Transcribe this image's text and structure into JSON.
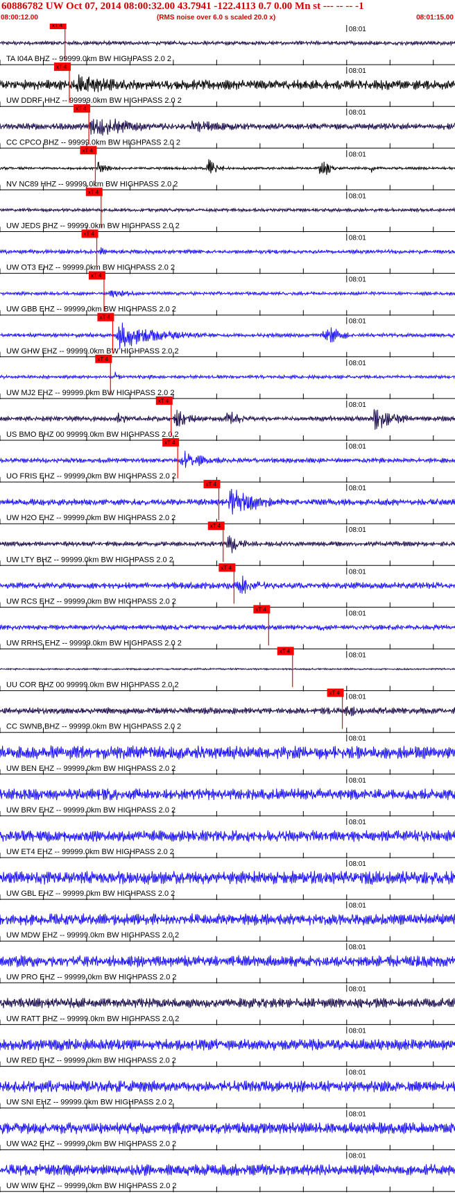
{
  "header": {
    "title": "60886782 UW Oct 07, 2014 08:00:32.00   43.7941 -122.4113  0.7 0.00 Mn st --- -- --   -1",
    "start_time": "08:00:12.00",
    "rms_note": "(RMS noise over 6.0 s scaled 20.0 x)",
    "end_time": "08:01:15.00"
  },
  "colors": {
    "header_red": "#d40000",
    "blue_trace": "#1a10ff",
    "dark_trace": "#1a0a4a",
    "black_trace": "#000000",
    "pick_red": "#ff0000"
  },
  "chart_data": {
    "type": "line",
    "title": "60886782 UW Oct 07, 2014 08:00:32.00   43.7941 -122.4113  0.7 0.00 Mn st --- -- --   -1",
    "x_start": "08:00:12.00",
    "x_end": "08:01:15.00",
    "x_tick_label": "08:01",
    "x_tick_label_time_s": 48,
    "pick_label": "xT 4",
    "xlim_seconds": [
      0,
      63
    ],
    "grid": false,
    "series": [
      {
        "name": "TA I04A BHZ -- 99999.0km BW  HIGHPASS  2.0  2",
        "color": "dark",
        "pick_s": 9.0,
        "noise": 0.12,
        "events": []
      },
      {
        "name": "UW DDRF HHZ -- 99999.0km BW  HIGHPASS  2.0  2",
        "color": "black",
        "pick_s": 9.6,
        "noise": 0.3,
        "events": [
          [
            10.5,
            0.7,
            14
          ],
          [
            33,
            0.35,
            20
          ]
        ]
      },
      {
        "name": "CC CPCO BHZ -- 99999.0km BW  HIGHPASS  2.0  2",
        "color": "dark",
        "pick_s": 12.3,
        "noise": 0.2,
        "events": [
          [
            12.3,
            0.8,
            12
          ],
          [
            26,
            0.4,
            20
          ]
        ]
      },
      {
        "name": "NV NC89 HHZ -- 99999.0km BW  HIGHPASS  2.0  2",
        "color": "black",
        "pick_s": 13.2,
        "noise": 0.08,
        "events": [
          [
            13.3,
            1.0,
            2
          ],
          [
            28.5,
            1.0,
            2.5
          ],
          [
            44,
            1.0,
            2.5
          ],
          [
            51,
            0.5,
            1.5
          ]
        ]
      },
      {
        "name": "UW JEDS BHZ -- 99999.0km BW  HIGHPASS  2.0  2",
        "color": "dark",
        "pick_s": 14.0,
        "noise": 0.1,
        "events": []
      },
      {
        "name": "UW OT3 EHZ -- 99999.0km BW  HIGHPASS  2.0  2",
        "color": "blue",
        "pick_s": 13.4,
        "noise": 0.12,
        "events": [
          [
            13.6,
            0.5,
            1.5
          ]
        ]
      },
      {
        "name": "UW GBB EHZ -- 99999.0km BW  HIGHPASS  2.0  2",
        "color": "blue",
        "pick_s": 14.4,
        "noise": 0.1,
        "events": [
          [
            14.8,
            0.3,
            8
          ]
        ]
      },
      {
        "name": "UW GHW EHZ -- 99999.0km BW  HIGHPASS  2.0  2",
        "color": "blue",
        "pick_s": 15.6,
        "noise": 0.12,
        "events": [
          [
            16.0,
            0.9,
            12
          ],
          [
            44.5,
            0.8,
            5
          ]
        ]
      },
      {
        "name": "UW MJ2 EHZ -- 99999.0km BW  HIGHPASS  2.0  2",
        "color": "blue",
        "pick_s": 15.3,
        "noise": 0.1,
        "events": [
          [
            15.6,
            0.5,
            1.5
          ],
          [
            20.5,
            0.35,
            1.5
          ]
        ]
      },
      {
        "name": "US BMO BHZ 00 99999.0km BW  HIGHPASS  2.0  2",
        "color": "dark",
        "pick_s": 23.7,
        "noise": 0.15,
        "events": [
          [
            15.8,
            0.6,
            3
          ],
          [
            24.0,
            0.9,
            4
          ],
          [
            31.0,
            0.6,
            5
          ],
          [
            51.5,
            0.9,
            6
          ]
        ]
      },
      {
        "name": "UO FRIS EHZ -- 99999.0km BW  HIGHPASS  2.0  2",
        "color": "blue",
        "pick_s": 24.6,
        "noise": 0.15,
        "events": [
          [
            24.8,
            0.9,
            5
          ],
          [
            29.5,
            0.4,
            2
          ]
        ]
      },
      {
        "name": "UW H2O EHZ -- 99999.0km BW  HIGHPASS  2.0  2",
        "color": "blue",
        "pick_s": 30.3,
        "noise": 0.2,
        "events": [
          [
            31.5,
            0.9,
            10
          ]
        ]
      },
      {
        "name": "UW LTY BHZ -- 99999.0km BW  HIGHPASS  2.0  2",
        "color": "dark",
        "pick_s": 30.9,
        "noise": 0.15,
        "events": [
          [
            31.2,
            0.9,
            3.5
          ]
        ]
      },
      {
        "name": "UW RCS EHZ -- 99999.0km BW  HIGHPASS  2.0  2",
        "color": "blue",
        "pick_s": 32.4,
        "noise": 0.2,
        "events": [
          [
            32.6,
            0.8,
            6
          ]
        ]
      },
      {
        "name": "UW RRHS EHZ -- 99999.0km BW  HIGHPASS  2.0  2",
        "color": "blue",
        "pick_s": 37.2,
        "noise": 0.15,
        "events": [
          [
            6.9,
            0.4,
            0.6
          ],
          [
            44,
            0.3,
            6
          ]
        ]
      },
      {
        "name": "UU COR BHZ 00 99999.0km BW  HIGHPASS  2.0  2",
        "color": "dark",
        "pick_s": 40.5,
        "noise": 0.05,
        "events": []
      },
      {
        "name": "CC SWNB BHZ -- 99999.0km BW  HIGHPASS  2.0  2",
        "color": "dark",
        "pick_s": 47.4,
        "noise": 0.2,
        "events": [
          [
            47.7,
            0.9,
            2.5
          ]
        ]
      },
      {
        "name": "UW BEN EHZ -- 99999.0km BW  HIGHPASS  2.0  2",
        "color": "blue",
        "pick_s": null,
        "noise": 0.4,
        "events": []
      },
      {
        "name": "UW BRV EHZ -- 99999.0km BW  HIGHPASS  2.0  2",
        "color": "blue",
        "pick_s": null,
        "noise": 0.35,
        "events": []
      },
      {
        "name": "UW ET4 EHZ -- 99999.0km BW  HIGHPASS  2.0  2",
        "color": "blue",
        "pick_s": null,
        "noise": 0.35,
        "events": []
      },
      {
        "name": "UW GBL EHZ -- 99999.0km BW  HIGHPASS  2.0  2",
        "color": "blue",
        "pick_s": null,
        "noise": 0.4,
        "events": []
      },
      {
        "name": "UW MDW EHZ -- 99999.0km BW  HIGHPASS  2.0  2",
        "color": "blue",
        "pick_s": null,
        "noise": 0.35,
        "events": [
          [
            22,
            0.25,
            20
          ]
        ]
      },
      {
        "name": "UW PRO EHZ -- 99999.0km BW  HIGHPASS  2.0  2",
        "color": "blue",
        "pick_s": null,
        "noise": 0.35,
        "events": []
      },
      {
        "name": "UW RATT BHZ -- 99999.0km BW  HIGHPASS  2.0  2",
        "color": "dark",
        "pick_s": null,
        "noise": 0.3,
        "events": []
      },
      {
        "name": "UW RED EHZ -- 99999.0km BW  HIGHPASS  2.0  2",
        "color": "blue",
        "pick_s": null,
        "noise": 0.35,
        "events": [
          [
            18,
            0.2,
            4
          ]
        ]
      },
      {
        "name": "UW SNI EHZ -- 99999.0km BW  HIGHPASS  2.0  2",
        "color": "blue",
        "pick_s": null,
        "noise": 0.35,
        "events": []
      },
      {
        "name": "UW WA2 EHZ -- 99999.0km BW  HIGHPASS  2.0  2",
        "color": "blue",
        "pick_s": null,
        "noise": 0.35,
        "events": []
      },
      {
        "name": "UW WIW EHZ -- 99999.0km BW  HIGHPASS  2.0  2",
        "color": "blue",
        "pick_s": null,
        "noise": 0.35,
        "events": []
      }
    ]
  }
}
